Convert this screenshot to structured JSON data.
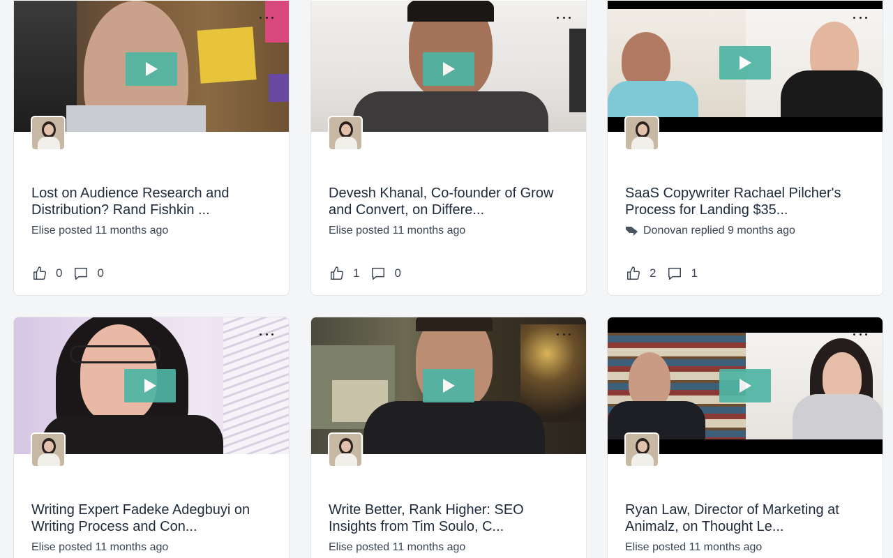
{
  "cards": [
    {
      "title": "Lost on Audience Research and Distribution? Rand Fishkin ...",
      "meta": "Elise posted 11 months ago",
      "likes": "0",
      "comments": "0",
      "has_reply": false
    },
    {
      "title": "Devesh Khanal, Co-founder of Grow and Convert, on Differe...",
      "meta": "Elise posted 11 months ago",
      "likes": "1",
      "comments": "0",
      "has_reply": false
    },
    {
      "title": "SaaS Copywriter Rachael Pilcher's Process for Landing $35...",
      "meta": "Donovan replied 9 months ago",
      "likes": "2",
      "comments": "1",
      "has_reply": true
    },
    {
      "title": "Writing Expert Fadeke Adegbuyi on Writing Process and Con...",
      "meta": "Elise posted 11 months ago"
    },
    {
      "title": "Write Better, Rank Higher: SEO Insights from Tim Soulo, C...",
      "meta": "Elise posted 11 months ago"
    },
    {
      "title": "Ryan Law, Director of Marketing at Animalz, on Thought Le...",
      "meta": "Elise posted 11 months ago"
    }
  ],
  "icons": {
    "play": "play-icon",
    "like": "thumbs-up-icon",
    "comment": "comment-bubble-icon",
    "reply": "reply-arrow-icon",
    "more": "more-dots-icon"
  },
  "colors": {
    "play_button": "#4fb5a4",
    "card_bg": "#ffffff",
    "page_bg": "#f4f5f7"
  }
}
